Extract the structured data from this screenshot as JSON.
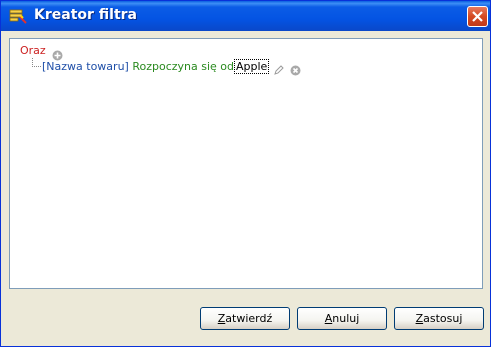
{
  "window": {
    "title": "Kreator filtra"
  },
  "filter": {
    "group_operator": "Oraz",
    "condition": {
      "field": "[Nazwa towaru]",
      "operator": "Rozpoczyna się od",
      "value": "Apple"
    }
  },
  "buttons": {
    "ok": {
      "mnemonic": "Z",
      "rest": "atwierdź"
    },
    "cancel": {
      "mnemonic": "A",
      "rest": "nuluj"
    },
    "apply": {
      "mnemonic": "Z",
      "rest": "astosuj"
    }
  },
  "icons": {
    "title": "filter-wand-icon",
    "add": "plus-circle-icon",
    "edit": "pencil-icon",
    "remove": "x-circle-icon",
    "close": "close-icon"
  },
  "colors": {
    "titlebar": "#0454e3",
    "operator_group": "#cc2222",
    "field": "#1f4fa8",
    "operator": "#2a8a1f"
  }
}
